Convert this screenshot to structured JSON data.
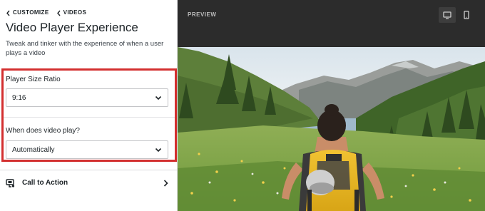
{
  "breadcrumb": [
    {
      "label": "Customize"
    },
    {
      "label": "Videos"
    }
  ],
  "title": "Video Player Experience",
  "description": "Tweak and tinker with the experience of when a user plays a video",
  "fields": {
    "size_ratio": {
      "label": "Player Size Ratio",
      "value": "9:16"
    },
    "play_mode": {
      "label": "When does video play?",
      "value": "Automatically"
    }
  },
  "call_to_action": {
    "label": "Call to Action"
  },
  "preview": {
    "label": "PREVIEW",
    "device_modes": [
      {
        "name": "desktop",
        "active": true
      },
      {
        "name": "mobile",
        "active": false
      }
    ]
  },
  "colors": {
    "highlight": "#d32f2f",
    "preview_header": "#2c2c2c"
  }
}
